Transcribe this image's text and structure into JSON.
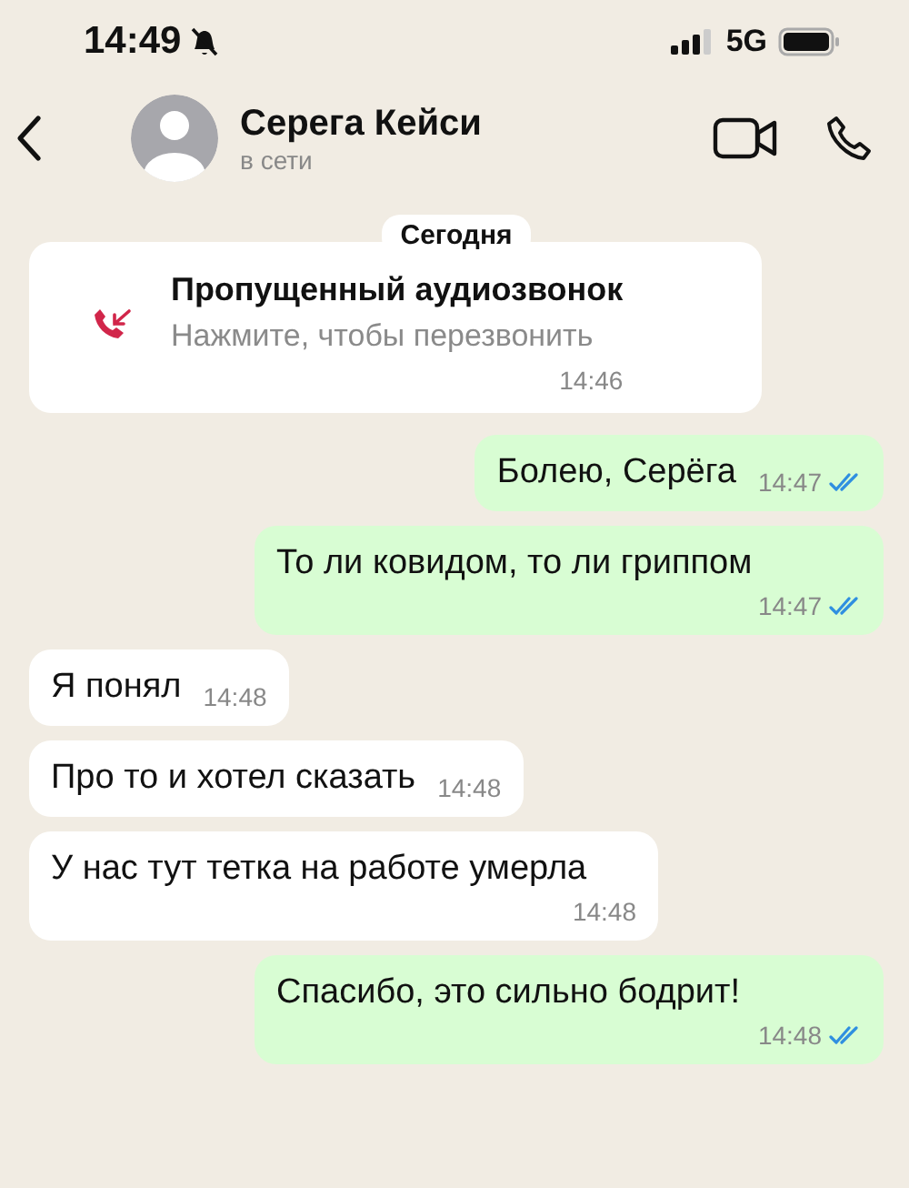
{
  "status_bar": {
    "time": "14:49",
    "muted": true,
    "network": "5G"
  },
  "header": {
    "name": "Серега Кейси",
    "status": "в сети"
  },
  "date_label": "Сегодня",
  "missed_call": {
    "title": "Пропущенный аудиозвонок",
    "subtitle": "Нажмите, чтобы перезвонить",
    "time": "14:46"
  },
  "messages": [
    {
      "kind": "out",
      "text": "Болею, Серёга",
      "time": "14:47",
      "read": true
    },
    {
      "kind": "out",
      "text": "То ли ковидом, то ли гриппом",
      "time": "14:47",
      "read": true
    },
    {
      "kind": "in",
      "text": "Я понял",
      "time": "14:48"
    },
    {
      "kind": "in",
      "text": "Про то и хотел сказать",
      "time": "14:48"
    },
    {
      "kind": "in",
      "text": "У нас тут тетка на работе умерла",
      "time": "14:48"
    },
    {
      "kind": "out",
      "text": "Спасибо, это сильно бодрит!",
      "time": "14:48",
      "read": true
    }
  ]
}
